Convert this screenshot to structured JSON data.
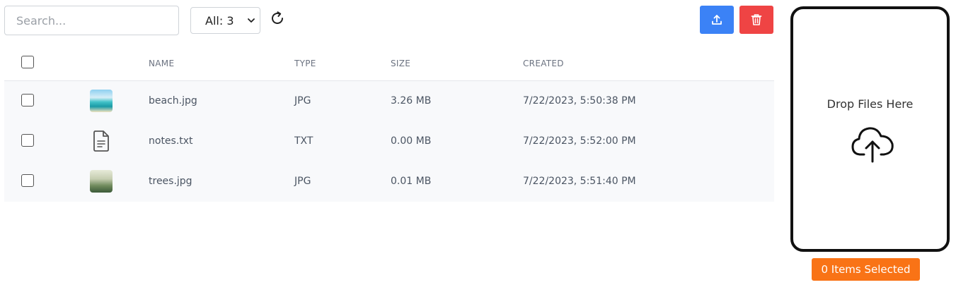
{
  "toolbar": {
    "search_placeholder": "Search...",
    "filter_value": "All: 3",
    "refresh_icon": "refresh-icon",
    "upload_icon": "upload-icon",
    "delete_icon": "trash-icon",
    "upload_color": "#3b82f6",
    "delete_color": "#ef4444"
  },
  "table": {
    "columns": [
      "NAME",
      "TYPE",
      "SIZE",
      "CREATED"
    ],
    "rows": [
      {
        "name": "beach.jpg",
        "type": "JPG",
        "size": "3.26 MB",
        "created": "7/22/2023, 5:50:38 PM",
        "thumb": "image-thumbnail"
      },
      {
        "name": "notes.txt",
        "type": "TXT",
        "size": "0.00 MB",
        "created": "7/22/2023, 5:52:00 PM",
        "thumb": "document-icon"
      },
      {
        "name": "trees.jpg",
        "type": "JPG",
        "size": "0.01 MB",
        "created": "7/22/2023, 5:51:40 PM",
        "thumb": "image-thumbnail"
      }
    ]
  },
  "dropzone": {
    "label": "Drop Files Here",
    "icon": "cloud-upload-icon"
  },
  "status": {
    "selected_label": "0 Items Selected",
    "badge_color": "#f97316"
  }
}
